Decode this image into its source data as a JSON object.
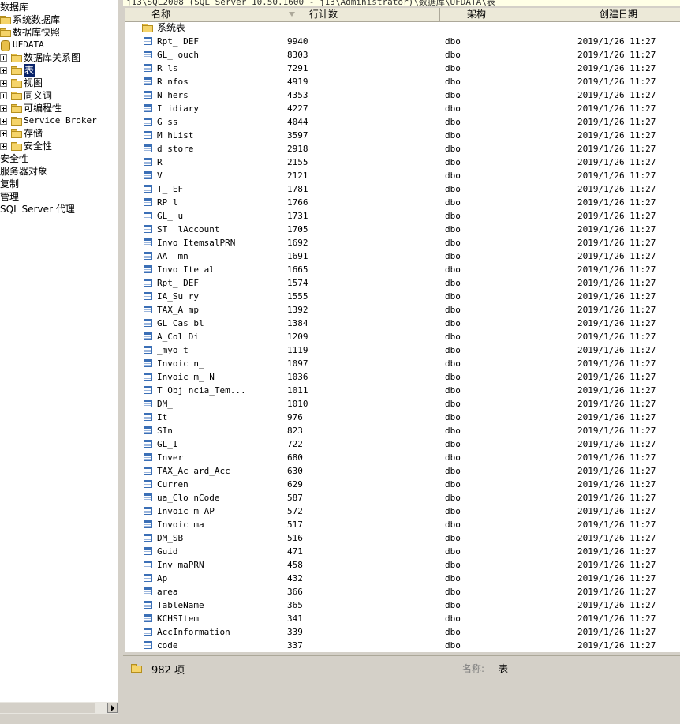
{
  "title_bar": "j13\\SQL2008 (SQL Server 10.50.1600 - j13\\Administrator)\\数据库\\UFDATA\\表",
  "tree": [
    {
      "label": "数据库",
      "indent": 0,
      "icon": "none",
      "expander": false
    },
    {
      "label": "系统数据库",
      "indent": 1,
      "icon": "folder",
      "expander": false
    },
    {
      "label": "数据库快照",
      "indent": 1,
      "icon": "folder",
      "expander": false
    },
    {
      "label": "UFDATA",
      "indent": 1,
      "icon": "database",
      "expander": false
    },
    {
      "label": "数据库关系图",
      "indent": 2,
      "icon": "folder",
      "expander": true
    },
    {
      "label": "表",
      "indent": 2,
      "icon": "folder",
      "expander": true,
      "selected": true
    },
    {
      "label": "视图",
      "indent": 2,
      "icon": "folder",
      "expander": true
    },
    {
      "label": "同义词",
      "indent": 2,
      "icon": "folder",
      "expander": true
    },
    {
      "label": "可编程性",
      "indent": 2,
      "icon": "folder",
      "expander": true
    },
    {
      "label": "Service Broker",
      "indent": 2,
      "icon": "folder",
      "expander": true
    },
    {
      "label": "存储",
      "indent": 2,
      "icon": "folder",
      "expander": true
    },
    {
      "label": "安全性",
      "indent": 2,
      "icon": "folder",
      "expander": true
    },
    {
      "label": "安全性",
      "indent": 0,
      "icon": "none",
      "expander": false
    },
    {
      "label": "服务器对象",
      "indent": 0,
      "icon": "none",
      "expander": false
    },
    {
      "label": "复制",
      "indent": 0,
      "icon": "none",
      "expander": false
    },
    {
      "label": "管理",
      "indent": 0,
      "icon": "none",
      "expander": false
    },
    {
      "label": "SQL Server 代理",
      "indent": 0,
      "icon": "none",
      "expander": false
    }
  ],
  "columns": {
    "name": "名称",
    "rows": "行计数",
    "schema": "架构",
    "created": "创建日期"
  },
  "system_folder": "系统表",
  "rows": [
    {
      "name": "Rpt_    DEF",
      "count": "9940",
      "schema": "dbo",
      "date": "2019/1/26 11:27"
    },
    {
      "name": "GL_     ouch",
      "count": "8303",
      "schema": "dbo",
      "date": "2019/1/26 11:27"
    },
    {
      "name": "R       ls",
      "count": "7291",
      "schema": "dbo",
      "date": "2019/1/26 11:27"
    },
    {
      "name": "R      nfos",
      "count": "4919",
      "schema": "dbo",
      "date": "2019/1/26 11:27"
    },
    {
      "name": "N       hers",
      "count": "4353",
      "schema": "dbo",
      "date": "2019/1/26 11:27"
    },
    {
      "name": "I      idiary",
      "count": "4227",
      "schema": "dbo",
      "date": "2019/1/26 11:27"
    },
    {
      "name": "G       ss",
      "count": "4044",
      "schema": "dbo",
      "date": "2019/1/26 11:27"
    },
    {
      "name": "M      hList",
      "count": "3597",
      "schema": "dbo",
      "date": "2019/1/26 11:27"
    },
    {
      "name": "d      store",
      "count": "2918",
      "schema": "dbo",
      "date": "2019/1/26 11:27"
    },
    {
      "name": "R",
      "count": "2155",
      "schema": "dbo",
      "date": "2019/1/26 11:27"
    },
    {
      "name": "V",
      "count": "2121",
      "schema": "dbo",
      "date": "2019/1/26 11:27"
    },
    {
      "name": "T_       EF",
      "count": "1781",
      "schema": "dbo",
      "date": "2019/1/26 11:27"
    },
    {
      "name": "RP      l",
      "count": "1766",
      "schema": "dbo",
      "date": "2019/1/26 11:27"
    },
    {
      "name": "GL_    u",
      "count": "1731",
      "schema": "dbo",
      "date": "2019/1/26 11:27"
    },
    {
      "name": "ST_    lAccount",
      "count": "1705",
      "schema": "dbo",
      "date": "2019/1/26 11:27"
    },
    {
      "name": "Invo   ItemsalPRN",
      "count": "1692",
      "schema": "dbo",
      "date": "2019/1/26 11:27"
    },
    {
      "name": "AA_     mn",
      "count": "1691",
      "schema": "dbo",
      "date": "2019/1/26 11:27"
    },
    {
      "name": "Invo    Ite   al",
      "count": "1665",
      "schema": "dbo",
      "date": "2019/1/26 11:27"
    },
    {
      "name": "Rpt_    DEF",
      "count": "1574",
      "schema": "dbo",
      "date": "2019/1/26 11:27"
    },
    {
      "name": "IA_Su    ry",
      "count": "1555",
      "schema": "dbo",
      "date": "2019/1/26 11:27"
    },
    {
      "name": "TAX_A    mp",
      "count": "1392",
      "schema": "dbo",
      "date": "2019/1/26 11:27"
    },
    {
      "name": "GL_Cas    bl",
      "count": "1384",
      "schema": "dbo",
      "date": "2019/1/26 11:27"
    },
    {
      "name": "  A_Col    Di",
      "count": "1209",
      "schema": "dbo",
      "date": "2019/1/26 11:27"
    },
    {
      "name": "  _myo    t",
      "count": "1119",
      "schema": "dbo",
      "date": "2019/1/26 11:27"
    },
    {
      "name": "Invoic    n_",
      "count": "1097",
      "schema": "dbo",
      "date": "2019/1/26 11:27"
    },
    {
      "name": "Invoic    m_  N",
      "count": "1036",
      "schema": "dbo",
      "date": "2019/1/26 11:27"
    },
    {
      "name": "T   Obj   ncia_Tem...",
      "count": "1011",
      "schema": "dbo",
      "date": "2019/1/26 11:27"
    },
    {
      "name": "DM_",
      "count": "1010",
      "schema": "dbo",
      "date": "2019/1/26 11:27"
    },
    {
      "name": "It",
      "count": "976",
      "schema": "dbo",
      "date": "2019/1/26 11:27"
    },
    {
      "name": "SIn",
      "count": "823",
      "schema": "dbo",
      "date": "2019/1/26 11:27"
    },
    {
      "name": "GL_I",
      "count": "722",
      "schema": "dbo",
      "date": "2019/1/26 11:27"
    },
    {
      "name": "Inver",
      "count": "680",
      "schema": "dbo",
      "date": "2019/1/26 11:27"
    },
    {
      "name": "TAX_Ac    ard_Acc",
      "count": "630",
      "schema": "dbo",
      "date": "2019/1/26 11:27"
    },
    {
      "name": "Curren",
      "count": "629",
      "schema": "dbo",
      "date": "2019/1/26 11:27"
    },
    {
      "name": "ua_Clo    nCode",
      "count": "587",
      "schema": "dbo",
      "date": "2019/1/26 11:27"
    },
    {
      "name": "Invoic    m_AP",
      "count": "572",
      "schema": "dbo",
      "date": "2019/1/26 11:27"
    },
    {
      "name": "Invoic    ma",
      "count": "517",
      "schema": "dbo",
      "date": "2019/1/26 11:27"
    },
    {
      "name": "DM_SB",
      "count": "516",
      "schema": "dbo",
      "date": "2019/1/26 11:27"
    },
    {
      "name": "Guid",
      "count": "471",
      "schema": "dbo",
      "date": "2019/1/26 11:27"
    },
    {
      "name": "Inv    maPRN",
      "count": "458",
      "schema": "dbo",
      "date": "2019/1/26 11:27"
    },
    {
      "name": "Ap_",
      "count": "432",
      "schema": "dbo",
      "date": "2019/1/26 11:27"
    },
    {
      "name": "area",
      "count": "366",
      "schema": "dbo",
      "date": "2019/1/26 11:27"
    },
    {
      "name": "TableName",
      "count": "365",
      "schema": "dbo",
      "date": "2019/1/26 11:27"
    },
    {
      "name": "KCHSItem",
      "count": "341",
      "schema": "dbo",
      "date": "2019/1/26 11:27"
    },
    {
      "name": "AccInformation",
      "count": "339",
      "schema": "dbo",
      "date": "2019/1/26 11:27"
    },
    {
      "name": "code",
      "count": "337",
      "schema": "dbo",
      "date": "2019/1/26 11:27"
    }
  ],
  "status": {
    "count": "982 项",
    "name_label": "名称:",
    "name_value": "表"
  }
}
